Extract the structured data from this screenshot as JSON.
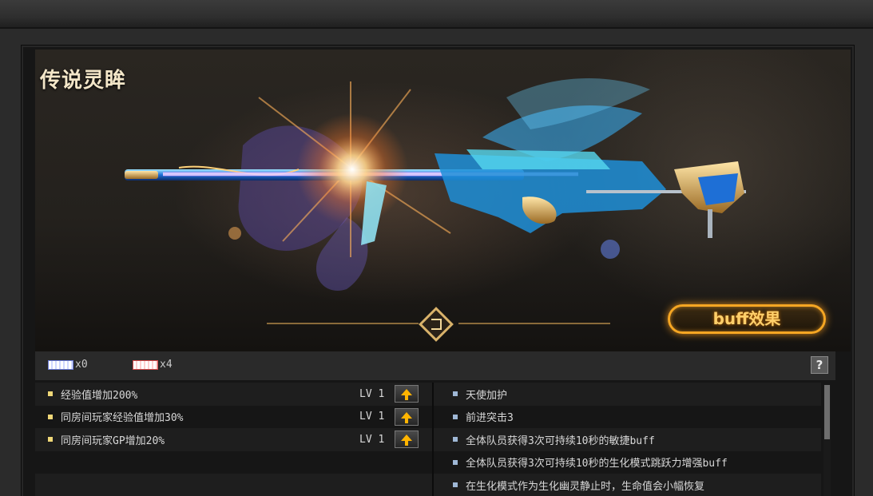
{
  "weapon": {
    "name": "传说灵眸"
  },
  "buttons": {
    "buff": "buff效果",
    "help": "?"
  },
  "badges": [
    {
      "icon": "white-blue-badge-icon",
      "count": "x0"
    },
    {
      "icon": "white-red-badge-icon",
      "count": "x4"
    }
  ],
  "bonuses": [
    {
      "label": "经验值增加200%",
      "level": "LV 1"
    },
    {
      "label": "同房间玩家经验值增加30%",
      "level": "LV 1"
    },
    {
      "label": "同房间玩家GP增加20%",
      "level": "LV 1"
    }
  ],
  "buffs": [
    "天使加护",
    "前进突击3",
    "全体队员获得3次可持续10秒的敏捷buff",
    "全体队员获得3次可持续10秒的生化模式跳跃力增强buff",
    "在生化模式作为生化幽灵静止时，生命值会小幅恢复"
  ],
  "colors": {
    "accent": "#f5a623",
    "title": "#f3e6c8",
    "bullet": "#f0d878"
  }
}
